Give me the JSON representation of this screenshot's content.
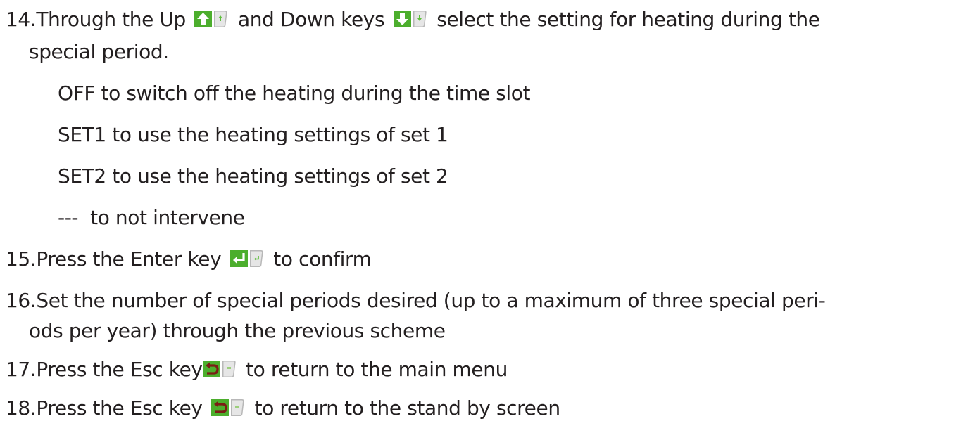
{
  "colors": {
    "text": "#231f20",
    "key_green": "#4cae2d",
    "key_face": "#b8b8b8",
    "key_inner": "#e6e6e6",
    "key_symbol_small": "#5cbf3a"
  },
  "icons": {
    "up_key": "up-arrow-key-icon",
    "down_key": "down-arrow-key-icon",
    "enter_key": "enter-key-icon",
    "esc_key": "esc-return-key-icon"
  },
  "step14": {
    "num": "14.",
    "text_a": "Through the Up",
    "text_b": "and Down keys",
    "text_c": "select the setting for heating during the",
    "text_d": "special period."
  },
  "options": [
    "OFF to switch off the heating during the time slot",
    "SET1 to use the heating settings of set 1",
    "SET2 to use the heating settings of set 2",
    "---  to not intervene"
  ],
  "step15": {
    "num": "15.",
    "text_a": "Press the Enter key",
    "text_b": "to confirm"
  },
  "step16": {
    "num": "16.",
    "text_a": "Set the number of special periods desired (up to a maximum of three special peri-",
    "text_b": "ods per year) through the previous scheme"
  },
  "step17": {
    "num": "17.",
    "text_a": "Press the Esc key",
    "text_b": "to return to the main menu"
  },
  "step18": {
    "num": "18.",
    "text_a": "Press the Esc key",
    "text_b": "to return to the stand by screen"
  }
}
